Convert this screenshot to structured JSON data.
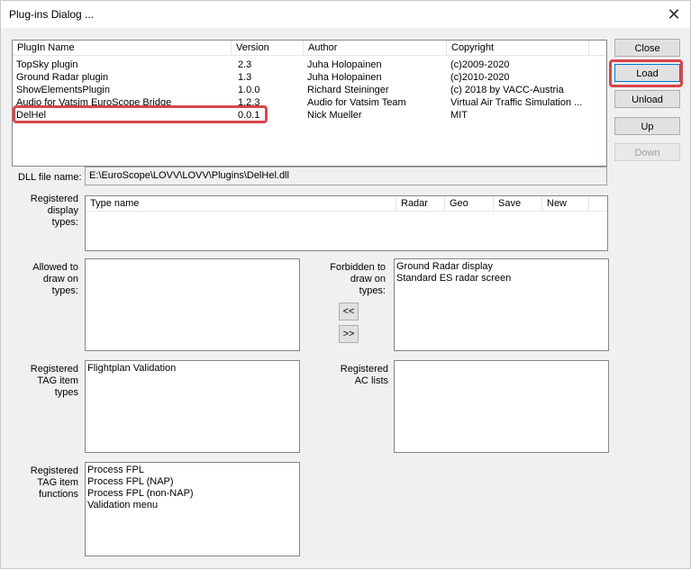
{
  "window": {
    "title": "Plug-ins Dialog ...",
    "close_glyph": "✕"
  },
  "plugins_table": {
    "columns": [
      "PlugIn Name",
      "Version",
      "Author",
      "Copyright"
    ],
    "rows": [
      {
        "name": "TopSky plugin",
        "version": "2.3",
        "author": "Juha Holopainen",
        "copyright": "(c)2009-2020"
      },
      {
        "name": "Ground Radar plugin",
        "version": "1.3",
        "author": "Juha Holopainen",
        "copyright": "(c)2010-2020"
      },
      {
        "name": "ShowElementsPlugin",
        "version": "1.0.0",
        "author": "Richard Steininger",
        "copyright": " (c) 2018 by VACC-Austria"
      },
      {
        "name": "Audio for Vatsim EuroScope Bridge",
        "version": "1.2.3",
        "author": "Audio for Vatsim Team",
        "copyright": "Virtual Air Traffic Simulation ..."
      },
      {
        "name": "DelHel",
        "version": "0.0.1",
        "author": "Nick Mueller",
        "copyright": "MIT"
      }
    ]
  },
  "buttons": {
    "close": "Close",
    "load": "Load",
    "unload": "Unload",
    "up": "Up",
    "down": "Down"
  },
  "dll": {
    "label": "DLL file name:",
    "value": "E:\\EuroScope\\LOVV\\LOVV\\Plugins\\DelHel.dll"
  },
  "display_types": {
    "label": [
      "Registered",
      "display",
      "types:"
    ],
    "columns": [
      "Type name",
      "Radar",
      "Geo",
      "Save",
      "New"
    ]
  },
  "allowed": {
    "label": [
      "Allowed to",
      "draw on",
      "types:"
    ]
  },
  "forbidden": {
    "label": [
      "Forbidden to",
      "draw on",
      "types:"
    ],
    "items": [
      "Ground Radar display",
      "Standard ES radar screen"
    ]
  },
  "move_buttons": {
    "left": "<<",
    "right": ">>"
  },
  "tag_item_types": {
    "label": [
      "Registered",
      "TAG item",
      "types"
    ],
    "items": [
      "Flightplan Validation"
    ]
  },
  "ac_lists": {
    "label": [
      "Registered",
      "AC lists"
    ]
  },
  "tag_item_functions": {
    "label": [
      "Registered",
      "TAG item",
      "functions"
    ],
    "items": [
      "Process FPL",
      "Process FPL (NAP)",
      "Process FPL (non-NAP)",
      "Validation menu"
    ]
  },
  "colors": {
    "highlight": "#d9454b"
  }
}
